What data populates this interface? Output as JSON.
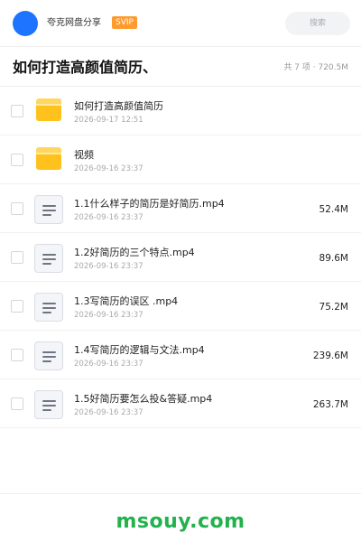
{
  "header": {
    "user_name": "夸克网盘分享",
    "badge": "SVIP",
    "search_placeholder": "搜索",
    "accent_color": "#1f74ff"
  },
  "title_bar": {
    "title": "如何打造高颜值简历、",
    "summary": "共 7 项 · 720.5M"
  },
  "files": [
    {
      "type": "folder",
      "icon": "folder-icon",
      "name": "如何打造高颜值简历",
      "date": "2026-09-17 12:51",
      "size": ""
    },
    {
      "type": "folder",
      "icon": "folder-icon",
      "name": "视频",
      "date": "2026-09-16 23:37",
      "size": ""
    },
    {
      "type": "file",
      "icon": "document-icon",
      "name": "1.1什么样子的简历是好简历.mp4",
      "date": "2026-09-16 23:37",
      "size": "52.4M"
    },
    {
      "type": "file",
      "icon": "document-icon",
      "name": "1.2好简历的三个特点.mp4",
      "date": "2026-09-16 23:37",
      "size": "89.6M"
    },
    {
      "type": "file",
      "icon": "document-icon",
      "name": "1.3写简历的误区 .mp4",
      "date": "2026-09-16 23:37",
      "size": "75.2M"
    },
    {
      "type": "file",
      "icon": "document-icon",
      "name": "1.4写简历的逻辑与文法.mp4",
      "date": "2026-09-16 23:37",
      "size": "239.6M"
    },
    {
      "type": "file",
      "icon": "document-icon",
      "name": "1.5好简历要怎么投&答疑.mp4",
      "date": "2026-09-16 23:37",
      "size": "263.7M"
    }
  ],
  "watermark": {
    "text": "msouy.com",
    "color": "#22b14c"
  }
}
